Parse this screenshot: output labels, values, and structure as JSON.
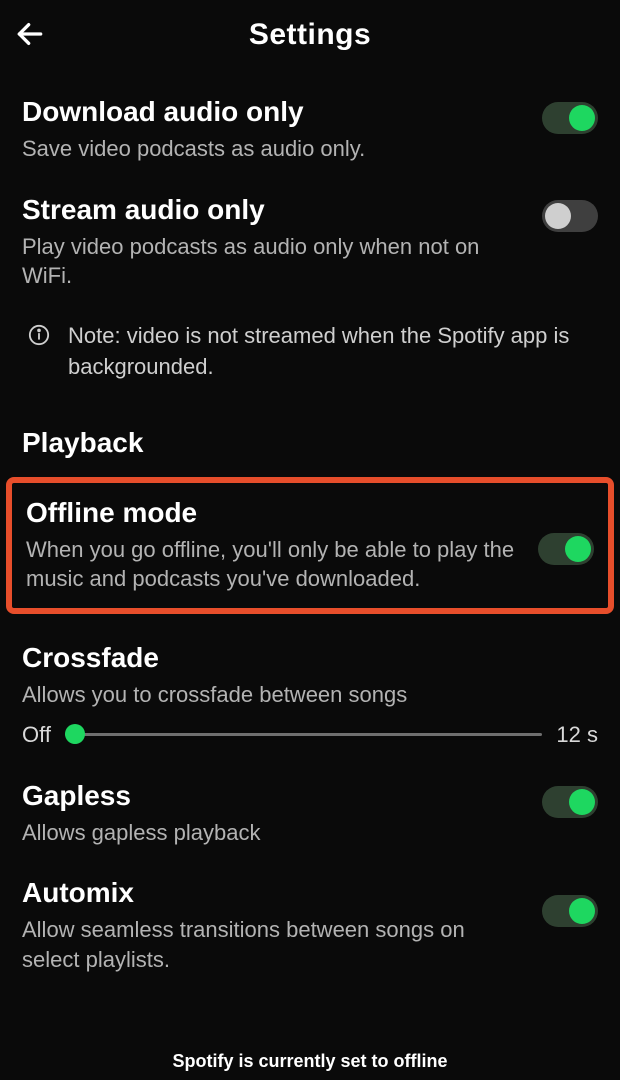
{
  "header": {
    "title": "Settings"
  },
  "settings": {
    "downloadAudio": {
      "title": "Download audio only",
      "desc": "Save video podcasts as audio only."
    },
    "streamAudio": {
      "title": "Stream audio only",
      "desc": "Play video podcasts as audio only when not on WiFi."
    },
    "note": "Note: video is not streamed when the Spotify app is backgrounded.",
    "playbackSection": "Playback",
    "offline": {
      "title": "Offline mode",
      "desc": "When you go offline, you'll only be able to play the music and podcasts you've downloaded."
    },
    "crossfade": {
      "title": "Crossfade",
      "desc": "Allows you to crossfade between songs",
      "min": "Off",
      "max": "12 s"
    },
    "gapless": {
      "title": "Gapless",
      "desc": "Allows gapless playback"
    },
    "automix": {
      "title": "Automix",
      "desc": "Allow seamless transitions between songs on select playlists."
    }
  },
  "footer": "Spotify is currently set to offline"
}
